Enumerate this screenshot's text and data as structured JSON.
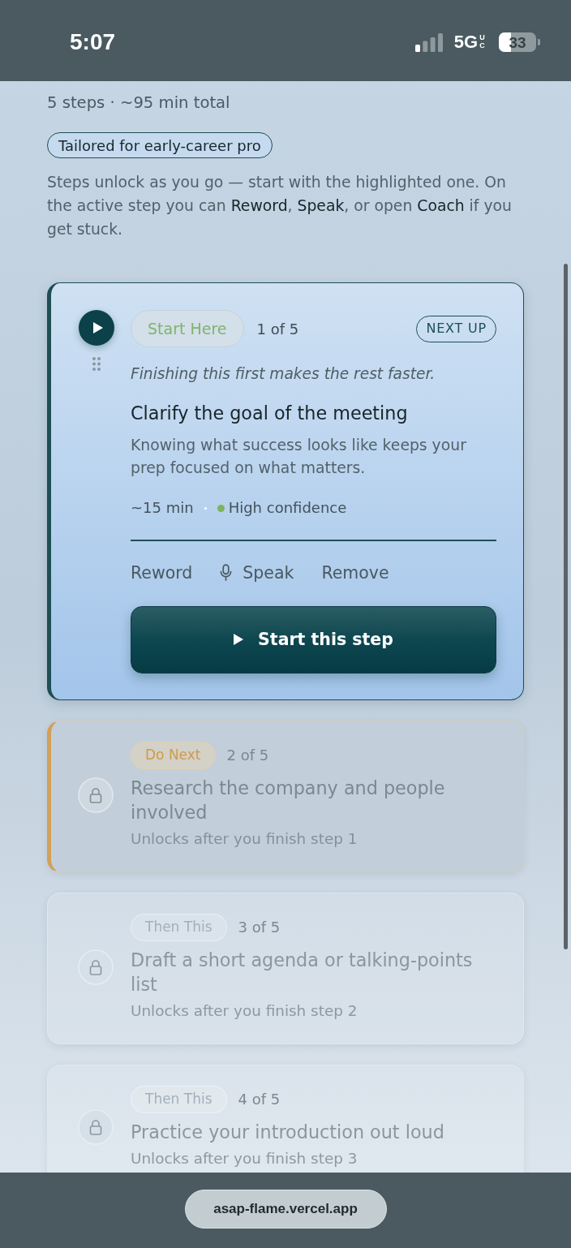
{
  "status_bar": {
    "time": "5:07",
    "network": "5G",
    "network_suffix": "UC",
    "battery": "33"
  },
  "summary": "5 steps · ~95 min total",
  "badge": "Tailored for early-career pro",
  "intro": "Steps unlock as you go — start with the highlighted one. On the active step you can **Reword**, **Speak**, or open **Coach** if you get stuck.",
  "steps": [
    {
      "kind": "active",
      "tag": "Start Here",
      "position": "1 of 5",
      "status": "NEXT UP",
      "hint": "Finishing this first makes the rest faster.",
      "title": "Clarify the goal of the meeting",
      "description": "Knowing what success looks like keeps your prep focused on what matters.",
      "duration": "~15 min",
      "confidence": {
        "label": "High confidence",
        "color": "#7cb55c"
      },
      "actions": [
        {
          "kind": "text",
          "label": "Reword"
        },
        {
          "kind": "voice",
          "label": "Speak"
        },
        {
          "kind": "text",
          "label": "Remove"
        }
      ],
      "start_button": "Start this step"
    },
    {
      "kind": "next",
      "tag": "Do Next",
      "position": "2 of 5",
      "title": "Research the company and people involved",
      "note": "Unlocks after you finish step 1"
    },
    {
      "kind": "later",
      "tag": "Then This",
      "position": "3 of 5",
      "title": "Draft a short agenda or talking-points list",
      "note": "Unlocks after you finish step 2"
    },
    {
      "kind": "later",
      "tag": "Then This",
      "position": "4 of 5",
      "title": "Practice your introduction out loud",
      "note": "Unlocks after you finish step 3"
    }
  ],
  "browser": {
    "url": "asap-flame.vercel.app"
  }
}
